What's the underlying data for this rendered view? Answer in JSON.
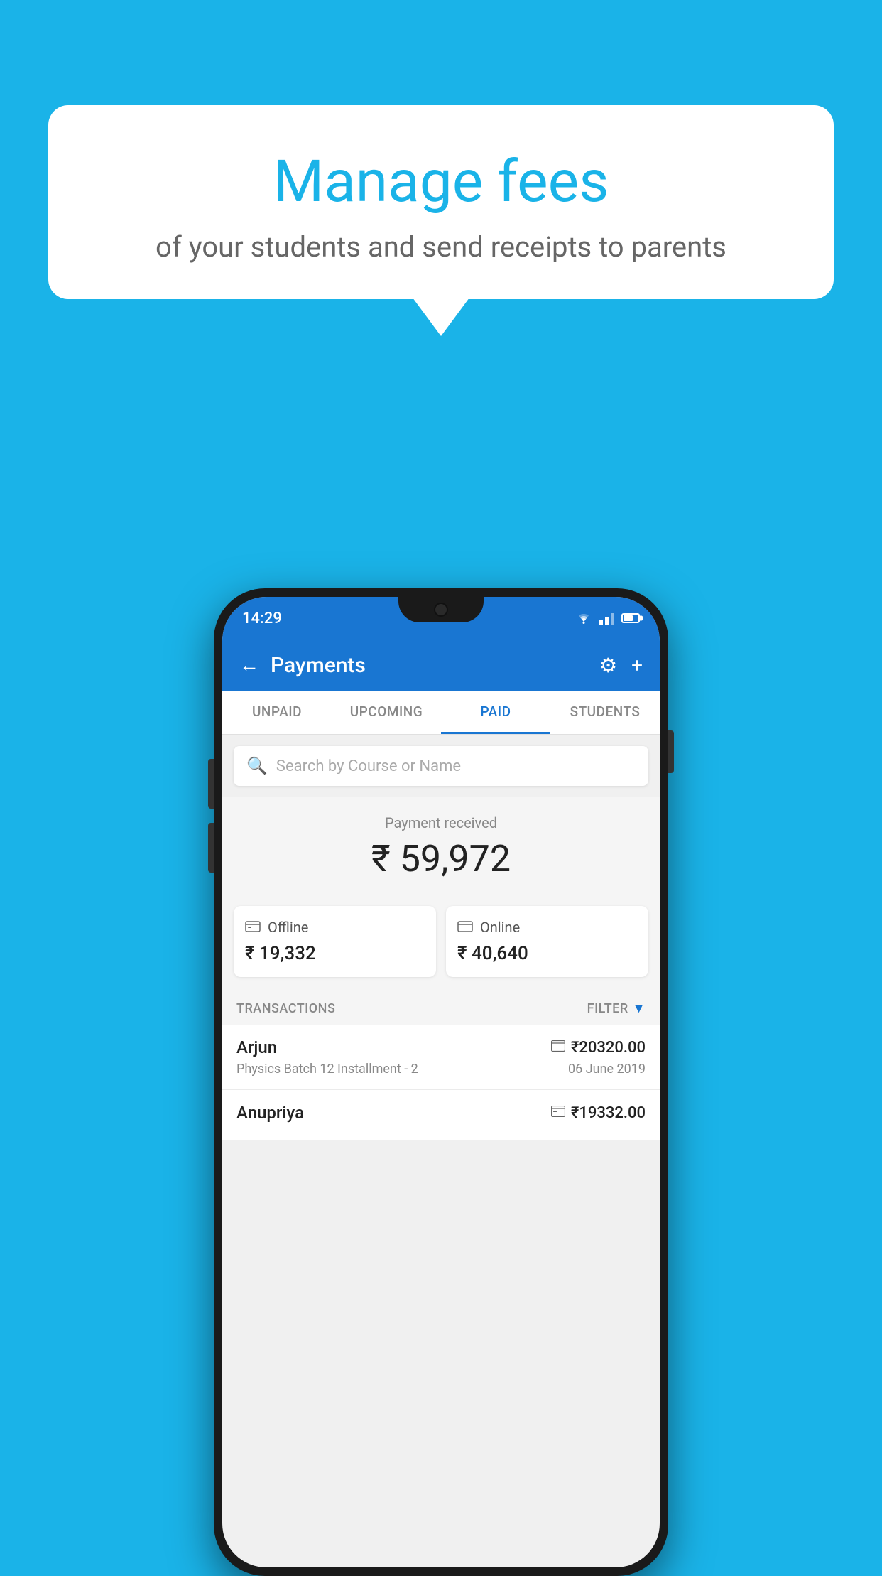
{
  "background_color": "#1ab3e8",
  "speech_bubble": {
    "title": "Manage fees",
    "subtitle": "of your students and send receipts to parents"
  },
  "status_bar": {
    "time": "14:29"
  },
  "header": {
    "title": "Payments",
    "back_label": "←",
    "gear_label": "⚙",
    "plus_label": "+"
  },
  "tabs": [
    {
      "label": "UNPAID",
      "active": false
    },
    {
      "label": "UPCOMING",
      "active": false
    },
    {
      "label": "PAID",
      "active": true
    },
    {
      "label": "STUDENTS",
      "active": false
    }
  ],
  "search": {
    "placeholder": "Search by Course or Name"
  },
  "payment_summary": {
    "label": "Payment received",
    "amount": "₹ 59,972",
    "offline": {
      "type": "Offline",
      "amount": "₹ 19,332"
    },
    "online": {
      "type": "Online",
      "amount": "₹ 40,640"
    }
  },
  "transactions": {
    "section_label": "TRANSACTIONS",
    "filter_label": "FILTER",
    "items": [
      {
        "name": "Arjun",
        "course": "Physics Batch 12 Installment - 2",
        "amount": "₹20320.00",
        "date": "06 June 2019",
        "method": "card"
      },
      {
        "name": "Anupriya",
        "course": "",
        "amount": "₹19332.00",
        "date": "",
        "method": "cash"
      }
    ]
  }
}
